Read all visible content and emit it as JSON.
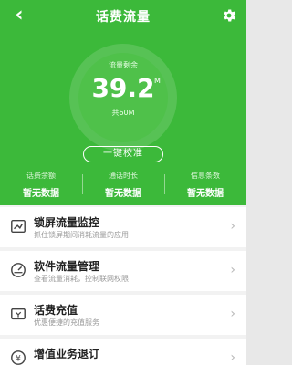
{
  "header": {
    "title": "话费流量",
    "back_icon": "chevron-left-icon",
    "settings_icon": "gear-icon"
  },
  "gauge": {
    "label": "流量剩余",
    "value": "39.2",
    "unit": "M",
    "total": "共60M"
  },
  "calibrate_button": "一键校准",
  "stats": [
    {
      "label": "话费余额",
      "value": "暂无数据"
    },
    {
      "label": "通话时长",
      "value": "暂无数据"
    },
    {
      "label": "信息条数",
      "value": "暂无数据"
    }
  ],
  "menu": [
    {
      "icon": "lock-screen-icon",
      "title": "锁屏流量监控",
      "subtitle": "抓住锁屏期间消耗流量的应用"
    },
    {
      "icon": "gauge-icon",
      "title": "软件流量管理",
      "subtitle": "查看流量消耗，控制联网权限"
    },
    {
      "icon": "wallet-icon",
      "title": "话费充值",
      "subtitle": "优惠便捷的充值服务"
    },
    {
      "icon": "coin-icon",
      "title": "增值业务退订",
      "subtitle": ""
    }
  ],
  "colors": {
    "brand_green": "#3cb93a",
    "text_dark": "#222222",
    "text_muted": "#9a9a9a"
  }
}
